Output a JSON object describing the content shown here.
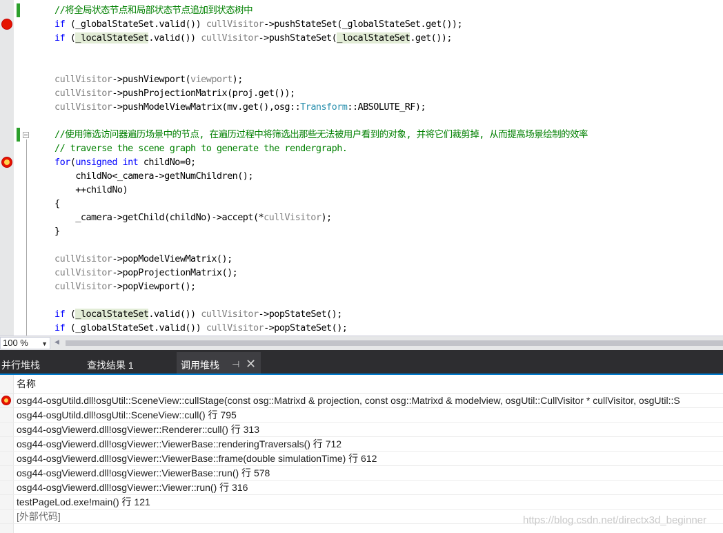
{
  "editor": {
    "lines": [
      {
        "segments": [
          {
            "t": "//将全局状态节点和局部状态节点追加到状态树中",
            "c": "cm"
          }
        ]
      },
      {
        "segments": [
          {
            "t": "if",
            "c": "kw"
          },
          {
            "t": " (_globalStateSet.valid()) "
          },
          {
            "t": "cullVisitor",
            "c": "gv"
          },
          {
            "t": "->pushStateSet(_globalStateSet.get());"
          }
        ]
      },
      {
        "segments": [
          {
            "t": "if",
            "c": "kw"
          },
          {
            "t": " ("
          },
          {
            "t": "_localStateSet",
            "c": "hl"
          },
          {
            "t": ".valid()) "
          },
          {
            "t": "cullVisitor",
            "c": "gv"
          },
          {
            "t": "->pushStateSet("
          },
          {
            "t": "_localStateSet",
            "c": "hl"
          },
          {
            "t": ".get());"
          }
        ]
      },
      {
        "segments": []
      },
      {
        "segments": []
      },
      {
        "segments": [
          {
            "t": "cullVisitor",
            "c": "gv"
          },
          {
            "t": "->pushViewport("
          },
          {
            "t": "viewport",
            "c": "gv"
          },
          {
            "t": ");"
          }
        ]
      },
      {
        "segments": [
          {
            "t": "cullVisitor",
            "c": "gv"
          },
          {
            "t": "->pushProjectionMatrix(proj.get());"
          }
        ]
      },
      {
        "segments": [
          {
            "t": "cullVisitor",
            "c": "gv"
          },
          {
            "t": "->pushModelViewMatrix(mv.get(),osg::"
          },
          {
            "t": "Transform",
            "c": "ty"
          },
          {
            "t": "::ABSOLUTE_RF);"
          }
        ]
      },
      {
        "segments": []
      },
      {
        "segments": [
          {
            "t": "//使用筛选访问器遍历场景中的节点, 在遍历过程中将筛选出那些无法被用户看到的对象, 并将它们裁剪掉, 从而提高场景绘制的效率",
            "c": "cm"
          }
        ]
      },
      {
        "segments": [
          {
            "t": "// traverse the scene graph to generate the rendergraph.",
            "c": "cm"
          }
        ]
      },
      {
        "segments": [
          {
            "t": "for",
            "c": "kw"
          },
          {
            "t": "("
          },
          {
            "t": "unsigned",
            "c": "kw"
          },
          {
            "t": " "
          },
          {
            "t": "int",
            "c": "kw"
          },
          {
            "t": " childNo=0;"
          }
        ]
      },
      {
        "segments": [
          {
            "t": "    childNo<_camera->getNumChildren();"
          }
        ]
      },
      {
        "segments": [
          {
            "t": "    ++childNo)"
          }
        ]
      },
      {
        "segments": [
          {
            "t": "{"
          }
        ]
      },
      {
        "segments": [
          {
            "t": "    _camera->getChild(childNo)->accept(*"
          },
          {
            "t": "cullVisitor",
            "c": "gv"
          },
          {
            "t": ");"
          }
        ]
      },
      {
        "segments": [
          {
            "t": "}"
          }
        ]
      },
      {
        "segments": []
      },
      {
        "segments": [
          {
            "t": "cullVisitor",
            "c": "gv"
          },
          {
            "t": "->popModelViewMatrix();"
          }
        ]
      },
      {
        "segments": [
          {
            "t": "cullVisitor",
            "c": "gv"
          },
          {
            "t": "->popProjectionMatrix();"
          }
        ]
      },
      {
        "segments": [
          {
            "t": "cullVisitor",
            "c": "gv"
          },
          {
            "t": "->popViewport();"
          }
        ]
      },
      {
        "segments": []
      },
      {
        "segments": [
          {
            "t": "if",
            "c": "kw"
          },
          {
            "t": " ("
          },
          {
            "t": "_localStateSet",
            "c": "hl"
          },
          {
            "t": ".valid()) "
          },
          {
            "t": "cullVisitor",
            "c": "gv"
          },
          {
            "t": "->popStateSet();"
          }
        ]
      },
      {
        "segments": [
          {
            "t": "if",
            "c": "kw"
          },
          {
            "t": " (_globalStateSet.valid()) "
          },
          {
            "t": "cullVisitor",
            "c": "gv"
          },
          {
            "t": "->popStateSet();"
          }
        ]
      }
    ],
    "breakpoints": [
      {
        "line": 1,
        "type": "breakpoint"
      },
      {
        "line": 11,
        "type": "current-statement"
      }
    ],
    "change_bar_lines": [
      0,
      9
    ]
  },
  "statusbar": {
    "zoom": "100 %"
  },
  "tool_window": {
    "tabs": [
      "并行堆栈",
      "查找结果 1",
      "调用堆栈"
    ],
    "active_tab": "调用堆栈",
    "pin_glyph": "⊣",
    "close_glyph": "✕"
  },
  "callstack": {
    "column_header": "名称",
    "rows": [
      {
        "text": "osg44-osgUtild.dll!osgUtil::SceneView::cullStage(const osg::Matrixd & projection, const osg::Matrixd & modelview, osgUtil::CullVisitor * cullVisitor, osgUtil::S",
        "current": true
      },
      {
        "text": "osg44-osgUtild.dll!osgUtil::SceneView::cull() 行 795"
      },
      {
        "text": "osg44-osgViewerd.dll!osgViewer::Renderer::cull() 行 313"
      },
      {
        "text": "osg44-osgViewerd.dll!osgViewer::ViewerBase::renderingTraversals() 行 712"
      },
      {
        "text": "osg44-osgViewerd.dll!osgViewer::ViewerBase::frame(double simulationTime) 行 612"
      },
      {
        "text": "osg44-osgViewerd.dll!osgViewer::ViewerBase::run() 行 578"
      },
      {
        "text": "osg44-osgViewerd.dll!osgViewer::Viewer::run() 行 316"
      },
      {
        "text": "testPageLod.exe!main() 行 121"
      },
      {
        "text": "[外部代码]",
        "external": true
      }
    ]
  },
  "watermark": "https://blog.csdn.net/directx3d_beginner"
}
